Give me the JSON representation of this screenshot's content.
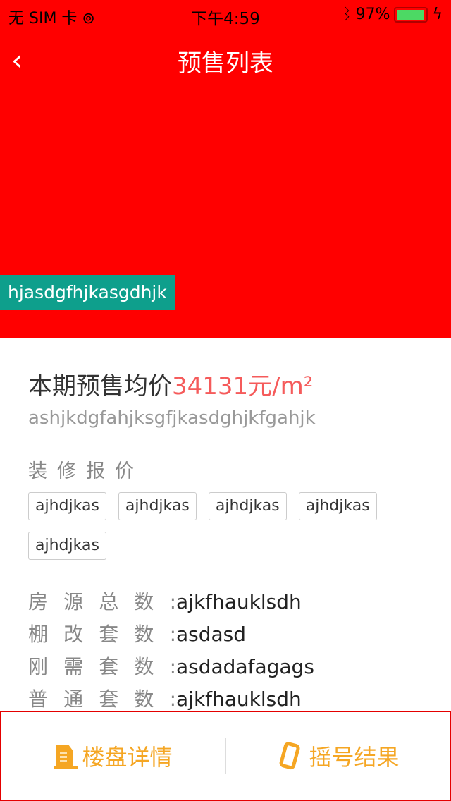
{
  "status": {
    "carrier": "无 SIM 卡",
    "time": "下午4:59",
    "battery": "97%",
    "battery_level": 0.97
  },
  "nav": {
    "back": "‹",
    "title": "预售列表"
  },
  "hero": {
    "overlay_text": "hjasdgfhjkasgdhjk"
  },
  "price": {
    "label": "本期预售均价",
    "value": "34131元/m²"
  },
  "subtitle": "ashjkdgfahjksgfjkasdghjkfgahjk",
  "decoration": {
    "title": "装修报价",
    "tags": [
      "ajhdjkas",
      "ajhdjkas",
      "ajhdjkas",
      "ajhdjkas",
      "ajhdjkas"
    ]
  },
  "stats": [
    {
      "label": [
        "房",
        "源",
        "总",
        "数"
      ],
      "value": "ajkfhauklsdh"
    },
    {
      "label": [
        "棚",
        "改",
        "套",
        "数"
      ],
      "value": "asdasd"
    },
    {
      "label": [
        "刚",
        "需",
        "套",
        "数"
      ],
      "value": "asdadafagags"
    },
    {
      "label": [
        "普",
        "通",
        "套",
        "数"
      ],
      "value": "ajkfhauklsdh"
    }
  ],
  "tabs": [
    {
      "label": "楼盘详情",
      "icon": "building-icon"
    },
    {
      "label": "摇号结果",
      "icon": "phone-shake-icon"
    }
  ]
}
